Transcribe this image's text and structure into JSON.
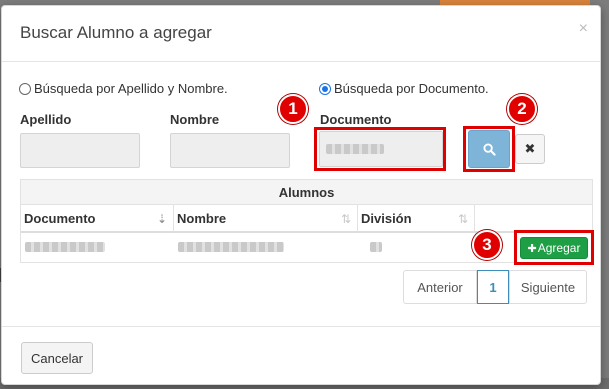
{
  "modal": {
    "title": "Buscar Alumno a agregar",
    "close_glyph": "×"
  },
  "search_mode": {
    "option_name": "Búsqueda por Apellido y Nombre.",
    "option_document": "Búsqueda por Documento.",
    "selected": "document"
  },
  "fields": {
    "apellido_label": "Apellido",
    "nombre_label": "Nombre",
    "documento_label": "Documento"
  },
  "buttons": {
    "search_icon": "search-icon",
    "clear_glyph": "✖",
    "agregar_label": "Agregar",
    "agregar_icon_glyph": "✚",
    "cancel_label": "Cancelar"
  },
  "table": {
    "caption": "Alumnos",
    "columns": [
      "Documento",
      "Nombre",
      "División"
    ],
    "sort_glyph_active": "⇣",
    "sort_glyph": "⇅"
  },
  "pagination": {
    "prev": "Anterior",
    "page": "1",
    "next": "Siguiente"
  },
  "annotations": [
    "1",
    "2",
    "3"
  ],
  "colors": {
    "highlight": "#e00000",
    "search_button": "#7fb4d9",
    "agregar_button": "#1e9e45",
    "radio_checked": "#1a73e8"
  }
}
